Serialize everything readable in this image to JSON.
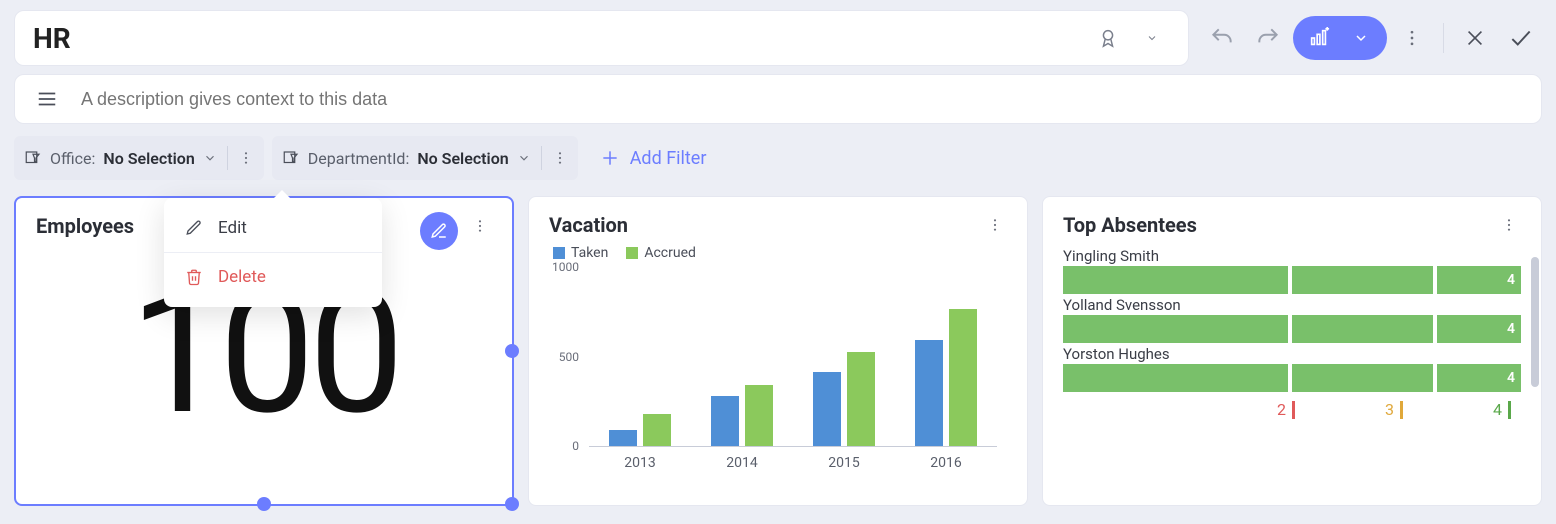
{
  "header": {
    "title": "HR",
    "description_placeholder": "A description gives context to this data"
  },
  "filters": [
    {
      "name": "Office",
      "label": "Office:",
      "value": "No Selection"
    },
    {
      "name": "DepartmentId",
      "label": "DepartmentId:",
      "value": "No Selection"
    }
  ],
  "add_filter_label": "Add Filter",
  "context_menu": {
    "edit": "Edit",
    "delete": "Delete"
  },
  "cards": {
    "employees": {
      "title": "Employees",
      "value": "100"
    },
    "vacation": {
      "title": "Vacation",
      "legend": {
        "taken": "Taken",
        "accrued": "Accrued"
      }
    },
    "absentees": {
      "title": "Top Absentees",
      "rows": [
        {
          "name": "Yingling Smith",
          "value": "4"
        },
        {
          "name": "Yolland Svensson",
          "value": "4"
        },
        {
          "name": "Yorston Hughes",
          "value": "4"
        }
      ],
      "legend": {
        "a": "2",
        "b": "3",
        "c": "4"
      }
    }
  },
  "chart_data": {
    "type": "bar",
    "title": "Vacation",
    "xlabel": "",
    "ylabel": "",
    "ylim": [
      0,
      1000
    ],
    "y_ticks": [
      0,
      500,
      1000
    ],
    "categories": [
      "2013",
      "2014",
      "2015",
      "2016"
    ],
    "series": [
      {
        "name": "Taken",
        "color": "#4f8fd6",
        "values": [
          90,
          280,
          410,
          590
        ]
      },
      {
        "name": "Accrued",
        "color": "#8bc95c",
        "values": [
          180,
          340,
          520,
          760
        ]
      }
    ]
  }
}
